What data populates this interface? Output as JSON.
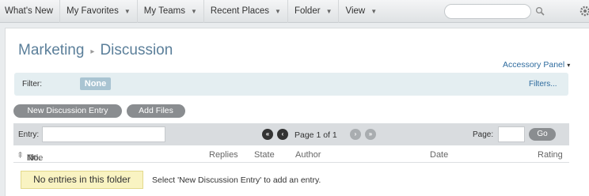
{
  "nav": {
    "items": [
      {
        "label": "What's New",
        "chevron": false
      },
      {
        "label": "My Favorites",
        "chevron": true
      },
      {
        "label": "My Teams",
        "chevron": true
      },
      {
        "label": "Recent Places",
        "chevron": true
      },
      {
        "label": "Folder",
        "chevron": true
      },
      {
        "label": "View",
        "chevron": true
      }
    ],
    "search_placeholder": "",
    "icons": [
      "search-icon",
      "gear-icon"
    ]
  },
  "breadcrumb": {
    "parent": "Marketing",
    "separator": "▸",
    "current": "Discussion"
  },
  "accessory_panel": {
    "label": "Accessory Panel",
    "caret": "▾"
  },
  "filter": {
    "label": "Filter:",
    "value": "None",
    "filters_link": "Filters..."
  },
  "actions": {
    "new_entry": "New Discussion Entry",
    "add_files": "Add Files"
  },
  "pager": {
    "entry_label": "Entry:",
    "entry_value": "",
    "status": "Page 1 of 1",
    "page_label": "Page:",
    "page_value": "",
    "go_label": "Go"
  },
  "table": {
    "columns": {
      "pin": "⇞",
      "no": "No.",
      "title": "Title",
      "replies": "Replies",
      "state": "State",
      "author": "Author",
      "date": "Date",
      "rating": "Rating"
    },
    "rows": []
  },
  "empty": {
    "message": "No entries in this folder",
    "hint": "Select 'New Discussion Entry' to add an entry."
  },
  "colors": {
    "breadcrumb": "#5b7f9a",
    "link": "#2e6b9e",
    "filter_bg": "#e4eef1",
    "filter_badge": "#a9c4d2",
    "button": "#8a8d90",
    "empty_bg": "#f9f3c2"
  }
}
